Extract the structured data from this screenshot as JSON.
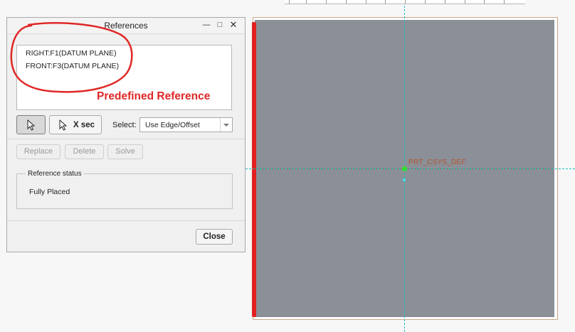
{
  "dialog": {
    "title": "References",
    "window_buttons": {
      "minimize": "—",
      "maximize": "□",
      "close": "✕"
    },
    "references": [
      "RIGHT:F1(DATUM PLANE)",
      "FRONT:F3(DATUM PLANE)"
    ],
    "xsec_label": "X sec",
    "select_label": "Select:",
    "select_value": "Use Edge/Offset",
    "buttons": {
      "replace": "Replace",
      "delete": "Delete",
      "solve": "Solve",
      "close": "Close"
    },
    "status_legend": "Reference status",
    "status_value": "Fully Placed"
  },
  "annotation": {
    "text": "Predefined Reference",
    "color": "#e02727"
  },
  "graphics": {
    "csys_label": "PRT_CSYS_DEF",
    "plane_color": "#8b9098",
    "axis_color": "#1fbfbf",
    "highlight_edge_color": "#e32020"
  }
}
